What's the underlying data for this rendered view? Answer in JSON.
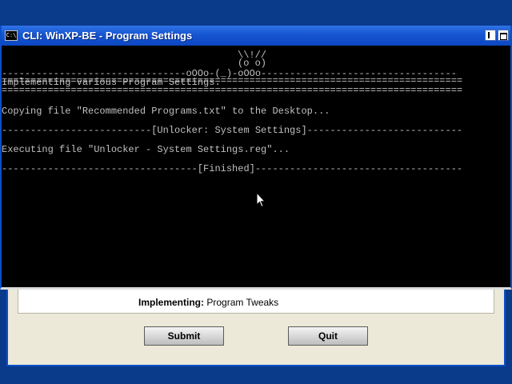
{
  "background_dialog": {
    "status_label": "Implementing:",
    "status_value": "Program Tweaks",
    "submit_label": "Submit",
    "quit_label": "Quit"
  },
  "console": {
    "title": "CLI: WinXP-BE - Program Settings",
    "icon_text": "C:\\",
    "lines": {
      "art1": "\\\\!//",
      "art2": "(o o)",
      "art3": "--------------------------------oOOo-(_)-oOOo----------------------------------",
      "sep1": "================================================================================",
      "l1": "Implementing various Program Settings.",
      "sep2": "================================================================================",
      "l2": "Copying file \"Recommended Programs.txt\" to the Desktop...",
      "sep3": "--------------------------[Unlocker: System Settings]---------------------------",
      "l3": "Executing file \"Unlocker - System Settings.reg\"...",
      "sep4": "----------------------------------[Finished]------------------------------------"
    }
  },
  "colors": {
    "titlebar": "#1655d1",
    "console_bg": "#000000",
    "console_text": "#c0c0c0",
    "desktop": "#0a3a8a"
  },
  "icons": [
    "console-icon",
    "minimize-icon",
    "maximize-icon",
    "mouse-cursor-icon"
  ]
}
